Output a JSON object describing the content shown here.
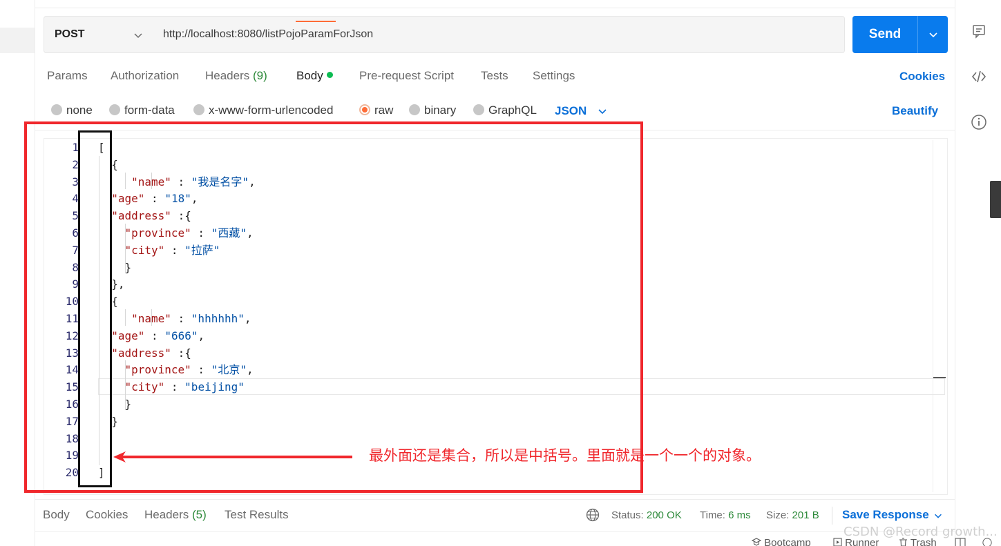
{
  "request": {
    "method": "POST",
    "url": "http://localhost:8080/listPojoParamForJson",
    "send_label": "Send"
  },
  "tabs": {
    "params": "Params",
    "authorization": "Authorization",
    "headers": "Headers",
    "headers_count": "(9)",
    "body": "Body",
    "prerequest": "Pre-request Script",
    "tests": "Tests",
    "settings": "Settings",
    "cookies": "Cookies"
  },
  "body_types": {
    "none": "none",
    "form_data": "form-data",
    "urlencoded": "x-www-form-urlencoded",
    "raw": "raw",
    "binary": "binary",
    "graphql": "GraphQL",
    "format": "JSON",
    "beautify": "Beautify",
    "selected": "raw"
  },
  "editor": {
    "lines": [
      {
        "n": "1",
        "t": "["
      },
      {
        "n": "2",
        "t": "{"
      },
      {
        "n": "3",
        "t": "\"name\" : \"我是名字\","
      },
      {
        "n": "4",
        "t": "\"age\" : \"18\","
      },
      {
        "n": "5",
        "t": "\"address\" :{"
      },
      {
        "n": "6",
        "t": "\"province\" : \"西藏\","
      },
      {
        "n": "7",
        "t": "\"city\" : \"拉萨\""
      },
      {
        "n": "8",
        "t": "}"
      },
      {
        "n": "9",
        "t": "},"
      },
      {
        "n": "10",
        "t": "{"
      },
      {
        "n": "11",
        "t": "\"name\" : \"hhhhhh\","
      },
      {
        "n": "12",
        "t": "\"age\" : \"666\","
      },
      {
        "n": "13",
        "t": "\"address\" :{"
      },
      {
        "n": "14",
        "t": "\"province\" : \"北京\","
      },
      {
        "n": "15",
        "t": "\"city\" : \"beijing\""
      },
      {
        "n": "16",
        "t": "}"
      },
      {
        "n": "17",
        "t": "}"
      },
      {
        "n": "18",
        "t": ""
      },
      {
        "n": "19",
        "t": ""
      },
      {
        "n": "20",
        "t": "]"
      }
    ]
  },
  "annotation": {
    "text": "最外面还是集合，所以是中括号。里面就是一个一个的对象。",
    "color": "#f0272c"
  },
  "response": {
    "body": "Body",
    "cookies": "Cookies",
    "headers": "Headers",
    "headers_count": "(5)",
    "test_results": "Test Results",
    "status_label": "Status:",
    "status_value": "200 OK",
    "time_label": "Time:",
    "time_value": "6 ms",
    "size_label": "Size:",
    "size_value": "201 B",
    "save_label": "Save Response"
  },
  "footer": {
    "bootcamp": "Bootcamp",
    "runner": "Runner",
    "trash": "Trash"
  },
  "watermark": "CSDN @Record growth...",
  "colors": {
    "accent": "#097bed",
    "link": "#0b6fd8",
    "active_tab": "#ff6c37",
    "success": "#2d8a3a"
  }
}
